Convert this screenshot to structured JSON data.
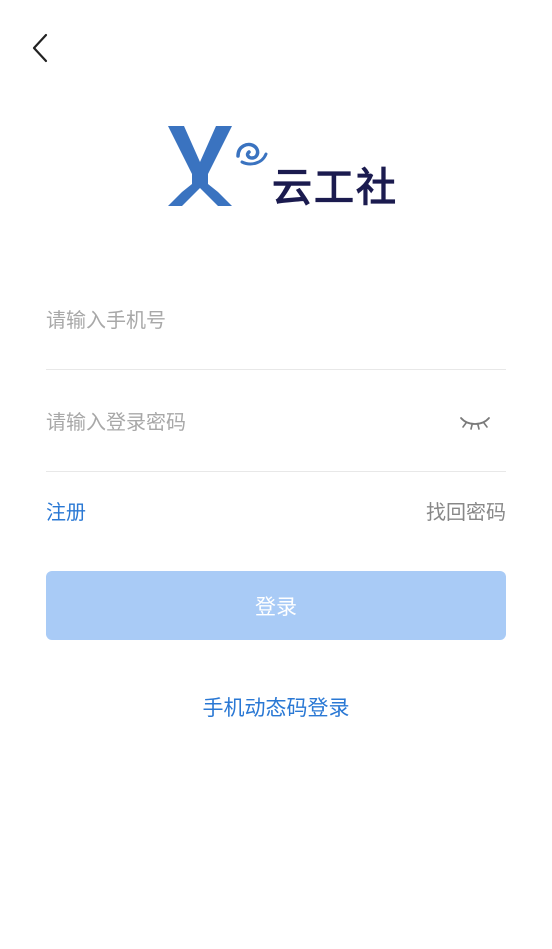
{
  "logo": {
    "name": "云工社",
    "brand_blue": "#3a73c0",
    "brand_navy": "#1b1b4f"
  },
  "nav": {
    "back_icon": "chevron-left-icon"
  },
  "form": {
    "phone_placeholder": "请输入手机号",
    "password_placeholder": "请输入登录密码",
    "eye_icon": "eye-closed-icon"
  },
  "links": {
    "register": "注册",
    "forgot_password": "找回密码"
  },
  "actions": {
    "login": "登录",
    "sms_login": "手机动态码登录"
  },
  "colors": {
    "accent": "#2a78d4",
    "button_disabled": "#a9cbf6",
    "placeholder": "#a8a8a8",
    "divider": "#e8e8e8"
  }
}
